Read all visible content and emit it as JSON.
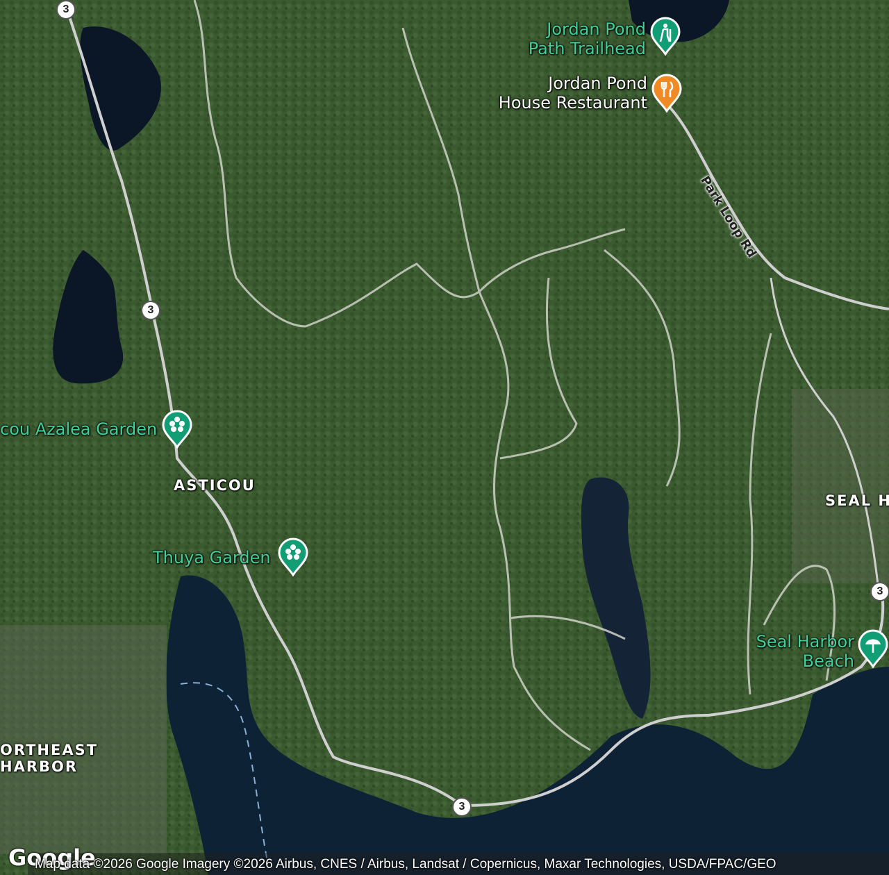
{
  "map": {
    "water_color": "#0c1a2a",
    "land_color": "#3a5a2e",
    "road_color": "#c9c9c9",
    "trail_color": "#d8d8d8"
  },
  "pois": {
    "jordan_pond_trailhead": {
      "label": "Jordan Pond\nPath Trailhead",
      "icon": "hiker-icon",
      "color": "#129e75"
    },
    "jordan_pond_house": {
      "label": "Jordan Pond\nHouse Restaurant",
      "icon": "fork-knife-icon",
      "color": "#f08a24"
    },
    "azalea_garden": {
      "label": "cou Azalea Garden",
      "icon": "flower-icon",
      "color": "#129e75"
    },
    "thuya_garden": {
      "label": "Thuya Garden",
      "icon": "flower-icon",
      "color": "#129e75"
    },
    "seal_harbor_beach": {
      "label": "Seal Harbor\nBeach",
      "icon": "umbrella-icon",
      "color": "#129e75"
    }
  },
  "places": {
    "asticou": "ASTICOU",
    "seal_harbor": "SEAL H",
    "northeast_harbor_line1": "ORTHEAST",
    "northeast_harbor_line2": "HARBOR"
  },
  "roads": {
    "park_loop": "Park Loop Rd",
    "route_shield": "3"
  },
  "footer": {
    "logo": "Google",
    "attribution": "Map data ©2026 Google Imagery ©2026 Airbus, CNES / Airbus, Landsat / Copernicus, Maxar Technologies, USDA/FPAC/GEO"
  }
}
